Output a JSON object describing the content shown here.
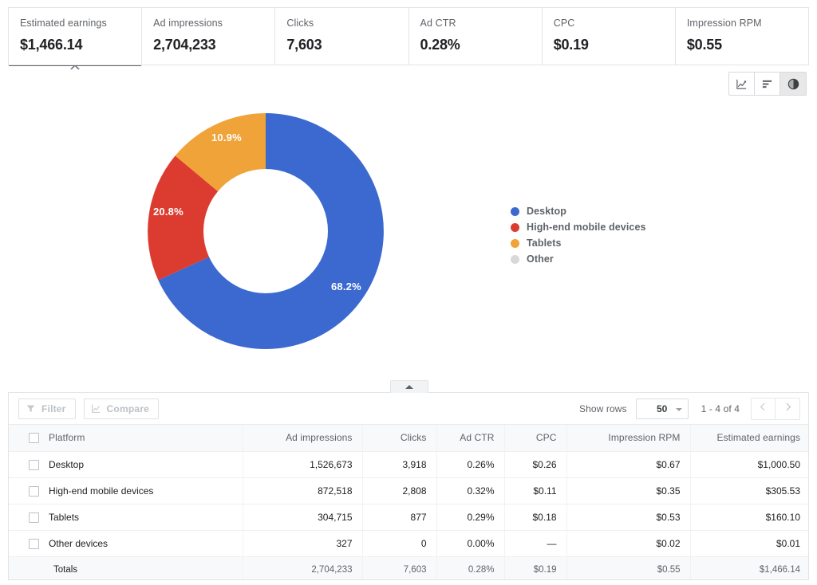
{
  "metrics": [
    {
      "label": "Estimated earnings",
      "value": "$1,466.14",
      "selected": true
    },
    {
      "label": "Ad impressions",
      "value": "2,704,233",
      "selected": false
    },
    {
      "label": "Clicks",
      "value": "7,603",
      "selected": false
    },
    {
      "label": "Ad CTR",
      "value": "0.28%",
      "selected": false
    },
    {
      "label": "CPC",
      "value": "$0.19",
      "selected": false
    },
    {
      "label": "Impression RPM",
      "value": "$0.55",
      "selected": false
    }
  ],
  "chart_toolbar": [
    {
      "name": "line-chart",
      "icon": "line-chart-icon",
      "active": false
    },
    {
      "name": "bar-chart",
      "icon": "bar-chart-icon",
      "active": false
    },
    {
      "name": "pie-chart",
      "icon": "pie-chart-icon",
      "active": true
    }
  ],
  "chart_data": {
    "type": "pie",
    "title": "",
    "variant": "donut",
    "metric": "Estimated earnings",
    "categories": [
      "Desktop",
      "High-end mobile devices",
      "Tablets",
      "Other"
    ],
    "values": [
      68.2,
      20.8,
      10.9,
      0.0
    ],
    "value_labels": [
      "68.2%",
      "20.8%",
      "10.9%",
      ""
    ],
    "colors": [
      "#3b69cf",
      "#dc3c30",
      "#f0a339",
      "#d7d8da"
    ],
    "legend_position": "right",
    "legend": [
      {
        "label": "Desktop",
        "color": "#3b69cf"
      },
      {
        "label": "High-end mobile devices",
        "color": "#dc3c30"
      },
      {
        "label": "Tablets",
        "color": "#f0a339"
      },
      {
        "label": "Other",
        "color": "#d7d8da"
      }
    ]
  },
  "collapse_handle": {
    "icon": "caret-up-icon"
  },
  "table_toolbar": {
    "filter_label": "Filter",
    "compare_label": "Compare",
    "show_rows_label": "Show rows",
    "rows_value": "50",
    "page_range": "1 - 4 of 4",
    "prev_icon": "chevron-left-icon",
    "next_icon": "chevron-right-icon"
  },
  "table": {
    "columns": [
      "Platform",
      "Ad impressions",
      "Clicks",
      "Ad CTR",
      "CPC",
      "Impression RPM",
      "Estimated earnings"
    ],
    "rows": [
      {
        "platform": "Desktop",
        "impressions": "1,526,673",
        "clicks": "3,918",
        "ctr": "0.26%",
        "cpc": "$0.26",
        "rpm": "$0.67",
        "earnings": "$1,000.50"
      },
      {
        "platform": "High-end mobile devices",
        "impressions": "872,518",
        "clicks": "2,808",
        "ctr": "0.32%",
        "cpc": "$0.11",
        "rpm": "$0.35",
        "earnings": "$305.53"
      },
      {
        "platform": "Tablets",
        "impressions": "304,715",
        "clicks": "877",
        "ctr": "0.29%",
        "cpc": "$0.18",
        "rpm": "$0.53",
        "earnings": "$160.10"
      },
      {
        "platform": "Other devices",
        "impressions": "327",
        "clicks": "0",
        "ctr": "0.00%",
        "cpc": "—",
        "rpm": "$0.02",
        "earnings": "$0.01"
      }
    ],
    "totals": {
      "platform": "Totals",
      "impressions": "2,704,233",
      "clicks": "7,603",
      "ctr": "0.28%",
      "cpc": "$0.19",
      "rpm": "$0.55",
      "earnings": "$1,466.14"
    }
  }
}
